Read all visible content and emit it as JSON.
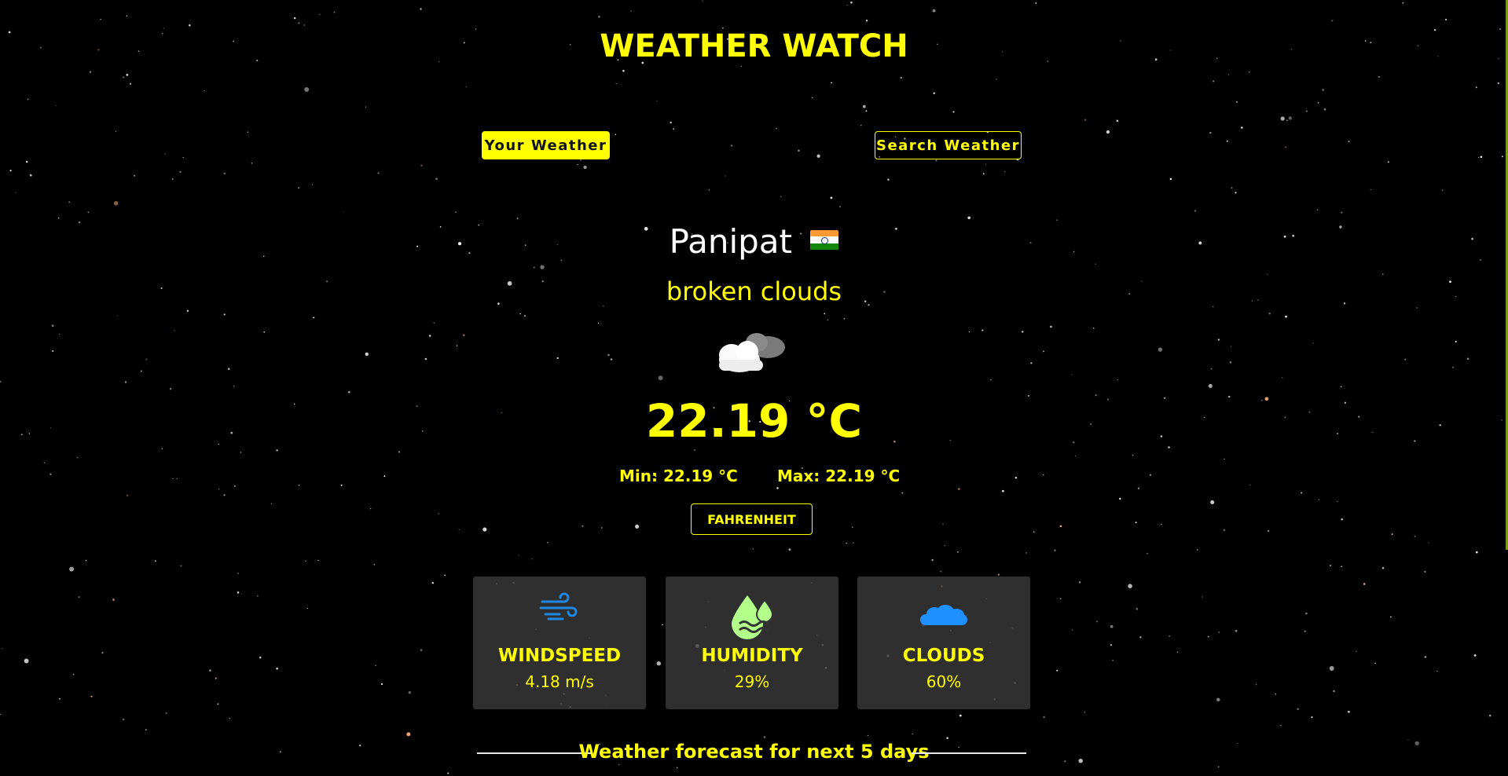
{
  "app": {
    "title": "WEATHER WATCH"
  },
  "tabs": {
    "your_weather": "Your Weather",
    "search_weather": "Search Weather"
  },
  "location": {
    "city": "Panipat",
    "country_flag": "india-flag"
  },
  "weather": {
    "description": "broken clouds",
    "icon": "broken-clouds-icon",
    "temperature": "22.19 °C",
    "min": "Min: 22.19 °C",
    "max": "Max: 22.19 °C",
    "unit_toggle": "FAHRENHEIT"
  },
  "stats": [
    {
      "label": "WINDSPEED",
      "value": "4.18 m/s",
      "icon": "wind-icon"
    },
    {
      "label": "HUMIDITY",
      "value": "29%",
      "icon": "humidity-icon"
    },
    {
      "label": "CLOUDS",
      "value": "60%",
      "icon": "cloud-icon"
    }
  ],
  "forecast": {
    "heading": "Weather forecast for next 5 days"
  },
  "colors": {
    "accent": "#ffff00",
    "background": "#000000",
    "card": "#3c3c3c",
    "wind_icon": "#1e88e5",
    "humidity_icon": "#b2ff8a",
    "cloud_icon": "#1e90ff"
  }
}
